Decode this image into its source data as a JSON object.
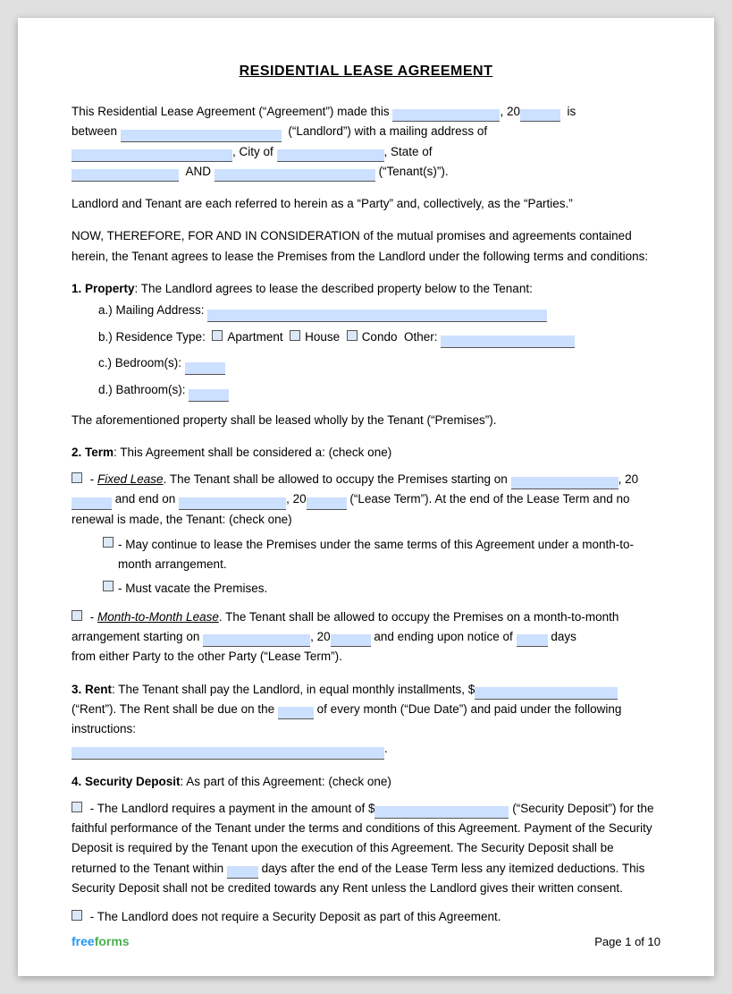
{
  "title": "RESIDENTIAL LEASE AGREEMENT",
  "intro": {
    "line1": "This Residential Lease Agreement (“Agreement”) made this",
    "year_prefix": ", 20",
    "year_suffix": " is",
    "line2_start": "between",
    "landlord_suffix": " (“Landlord”) with a mailing address of",
    "city_prefix": ", City of",
    "state_suffix": ", State of",
    "and_label": "AND",
    "tenant_suffix": "(“Tenant(s)”)."
  },
  "parties_note": "Landlord and Tenant are each referred to herein as a “Party” and, collectively, as the “Parties.”",
  "consideration": "NOW, THEREFORE, FOR AND IN CONSIDERATION of the mutual promises and agreements contained herein, the Tenant agrees to lease the Premises from the Landlord under the following terms and conditions:",
  "section1": {
    "heading": "1. Property",
    "text": ": The Landlord agrees to lease the described property below to the Tenant:",
    "sub_a": "a.)  Mailing Address:",
    "sub_b_prefix": "b.)  Residence Type:",
    "checkbox_apartment": "Apartment",
    "checkbox_house": "House",
    "checkbox_condo": "Condo",
    "checkbox_other_prefix": "Other:",
    "sub_c": "c.)  Bedroom(s):",
    "sub_d": "d.)  Bathroom(s):",
    "premises_text": "The aforementioned property shall be leased wholly by the Tenant (“Premises”)."
  },
  "section2": {
    "heading": "2. Term",
    "text": ": This Agreement shall be considered a: (check one)",
    "fixed_prefix": "- ",
    "fixed_label": "Fixed Lease",
    "fixed_text1": ". The Tenant shall be allowed to occupy the Premises starting on",
    "fixed_year1": ", 20",
    "fixed_and": " and end on",
    "fixed_year2": ", 20",
    "fixed_text2": " (“Lease Term”). At the end of the Lease Term and no renewal is made, the Tenant: (check one)",
    "sub_option1": "- May continue to lease the Premises under the same terms of this Agreement under a month-to-month arrangement.",
    "sub_option2": "- Must vacate the Premises.",
    "month_prefix": "- ",
    "month_label": "Month-to-Month Lease",
    "month_text": ". The Tenant shall be allowed to occupy the Premises on a month-to-month arrangement starting on",
    "month_year": ", 20",
    "month_ending": " and ending upon notice of",
    "month_days": "days",
    "month_from": "from either Party to the other Party (“Lease Term”)."
  },
  "section3": {
    "heading": "3. Rent",
    "text1": ": The Tenant shall pay the Landlord, in equal monthly installments, $",
    "rent_suffix": "(“Rent”). The Rent shall be due on the",
    "due_mid": "of every month (“Due Date”) and paid under the following instructions:",
    "period": "."
  },
  "section4": {
    "heading": "4. Security Deposit",
    "text": ": As part of this Agreement: (check one)",
    "option1_prefix": "- The Landlord requires a payment in the amount of $",
    "option1_suffix": "(“Security Deposit”) for the faithful performance of the Tenant under the terms and conditions of this Agreement. Payment of the Security Deposit is required by the Tenant upon the execution of this Agreement. The Security Deposit shall be returned to the Tenant within",
    "option1_days": "days after the end of the Lease Term less any itemized deductions. This Security Deposit shall not be credited towards any Rent unless the Landlord gives their written consent.",
    "option2": "- The Landlord does not require a Security Deposit as part of this Agreement."
  },
  "footer": {
    "free": "free",
    "forms": "forms",
    "page": "Page 1 of 10"
  }
}
